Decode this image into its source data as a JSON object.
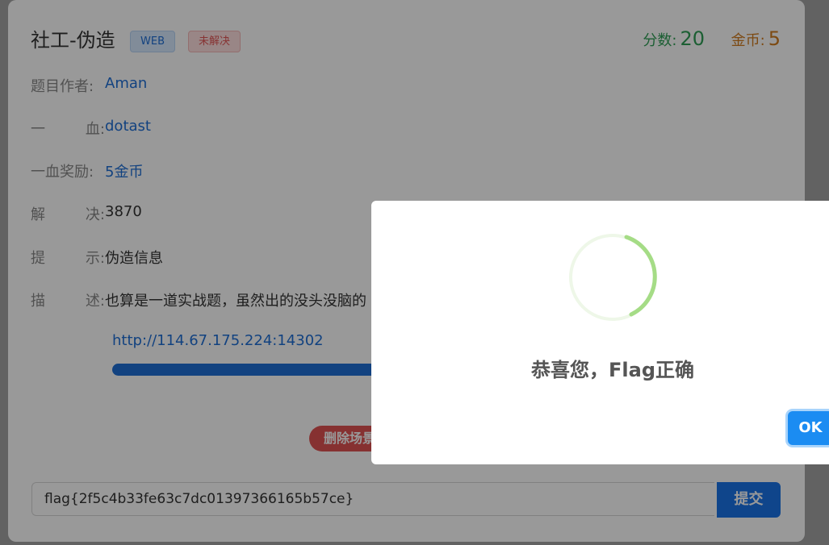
{
  "challenge": {
    "title": "社工-伪造",
    "category_tag": "WEB",
    "status_tag": "未解决",
    "score_label": "分数:",
    "score_value": "20",
    "coins_label": "金币:",
    "coins_value": "5"
  },
  "details": {
    "author_label": "题目作者:",
    "author_value": "Aman",
    "firstblood_label_1": "一",
    "firstblood_label_2": "血:",
    "firstblood_value": "dotast",
    "reward_label": "一血奖励:",
    "reward_value": "5金币",
    "solved_label_1": "解",
    "solved_label_2": "决:",
    "solved_value": "3870",
    "hint_label_1": "提",
    "hint_label_2": "示:",
    "hint_value": "伪造信息",
    "desc_label_1": "描",
    "desc_label_2": "述:",
    "desc_value": "也算是一道实战题，虽然出的没头没脑的"
  },
  "instance": {
    "url": "http://114.67.175.224:14302",
    "delete_label": "删除场景"
  },
  "submit": {
    "flag_value": "flag{2f5c4b33fe63c7dc01397366165b57ce}",
    "submit_label": "提交"
  },
  "modal": {
    "title": "恭喜您，Flag正确",
    "ok_label": "OK",
    "icon": "success-spinner-icon",
    "accent_color": "#a5dc86"
  }
}
